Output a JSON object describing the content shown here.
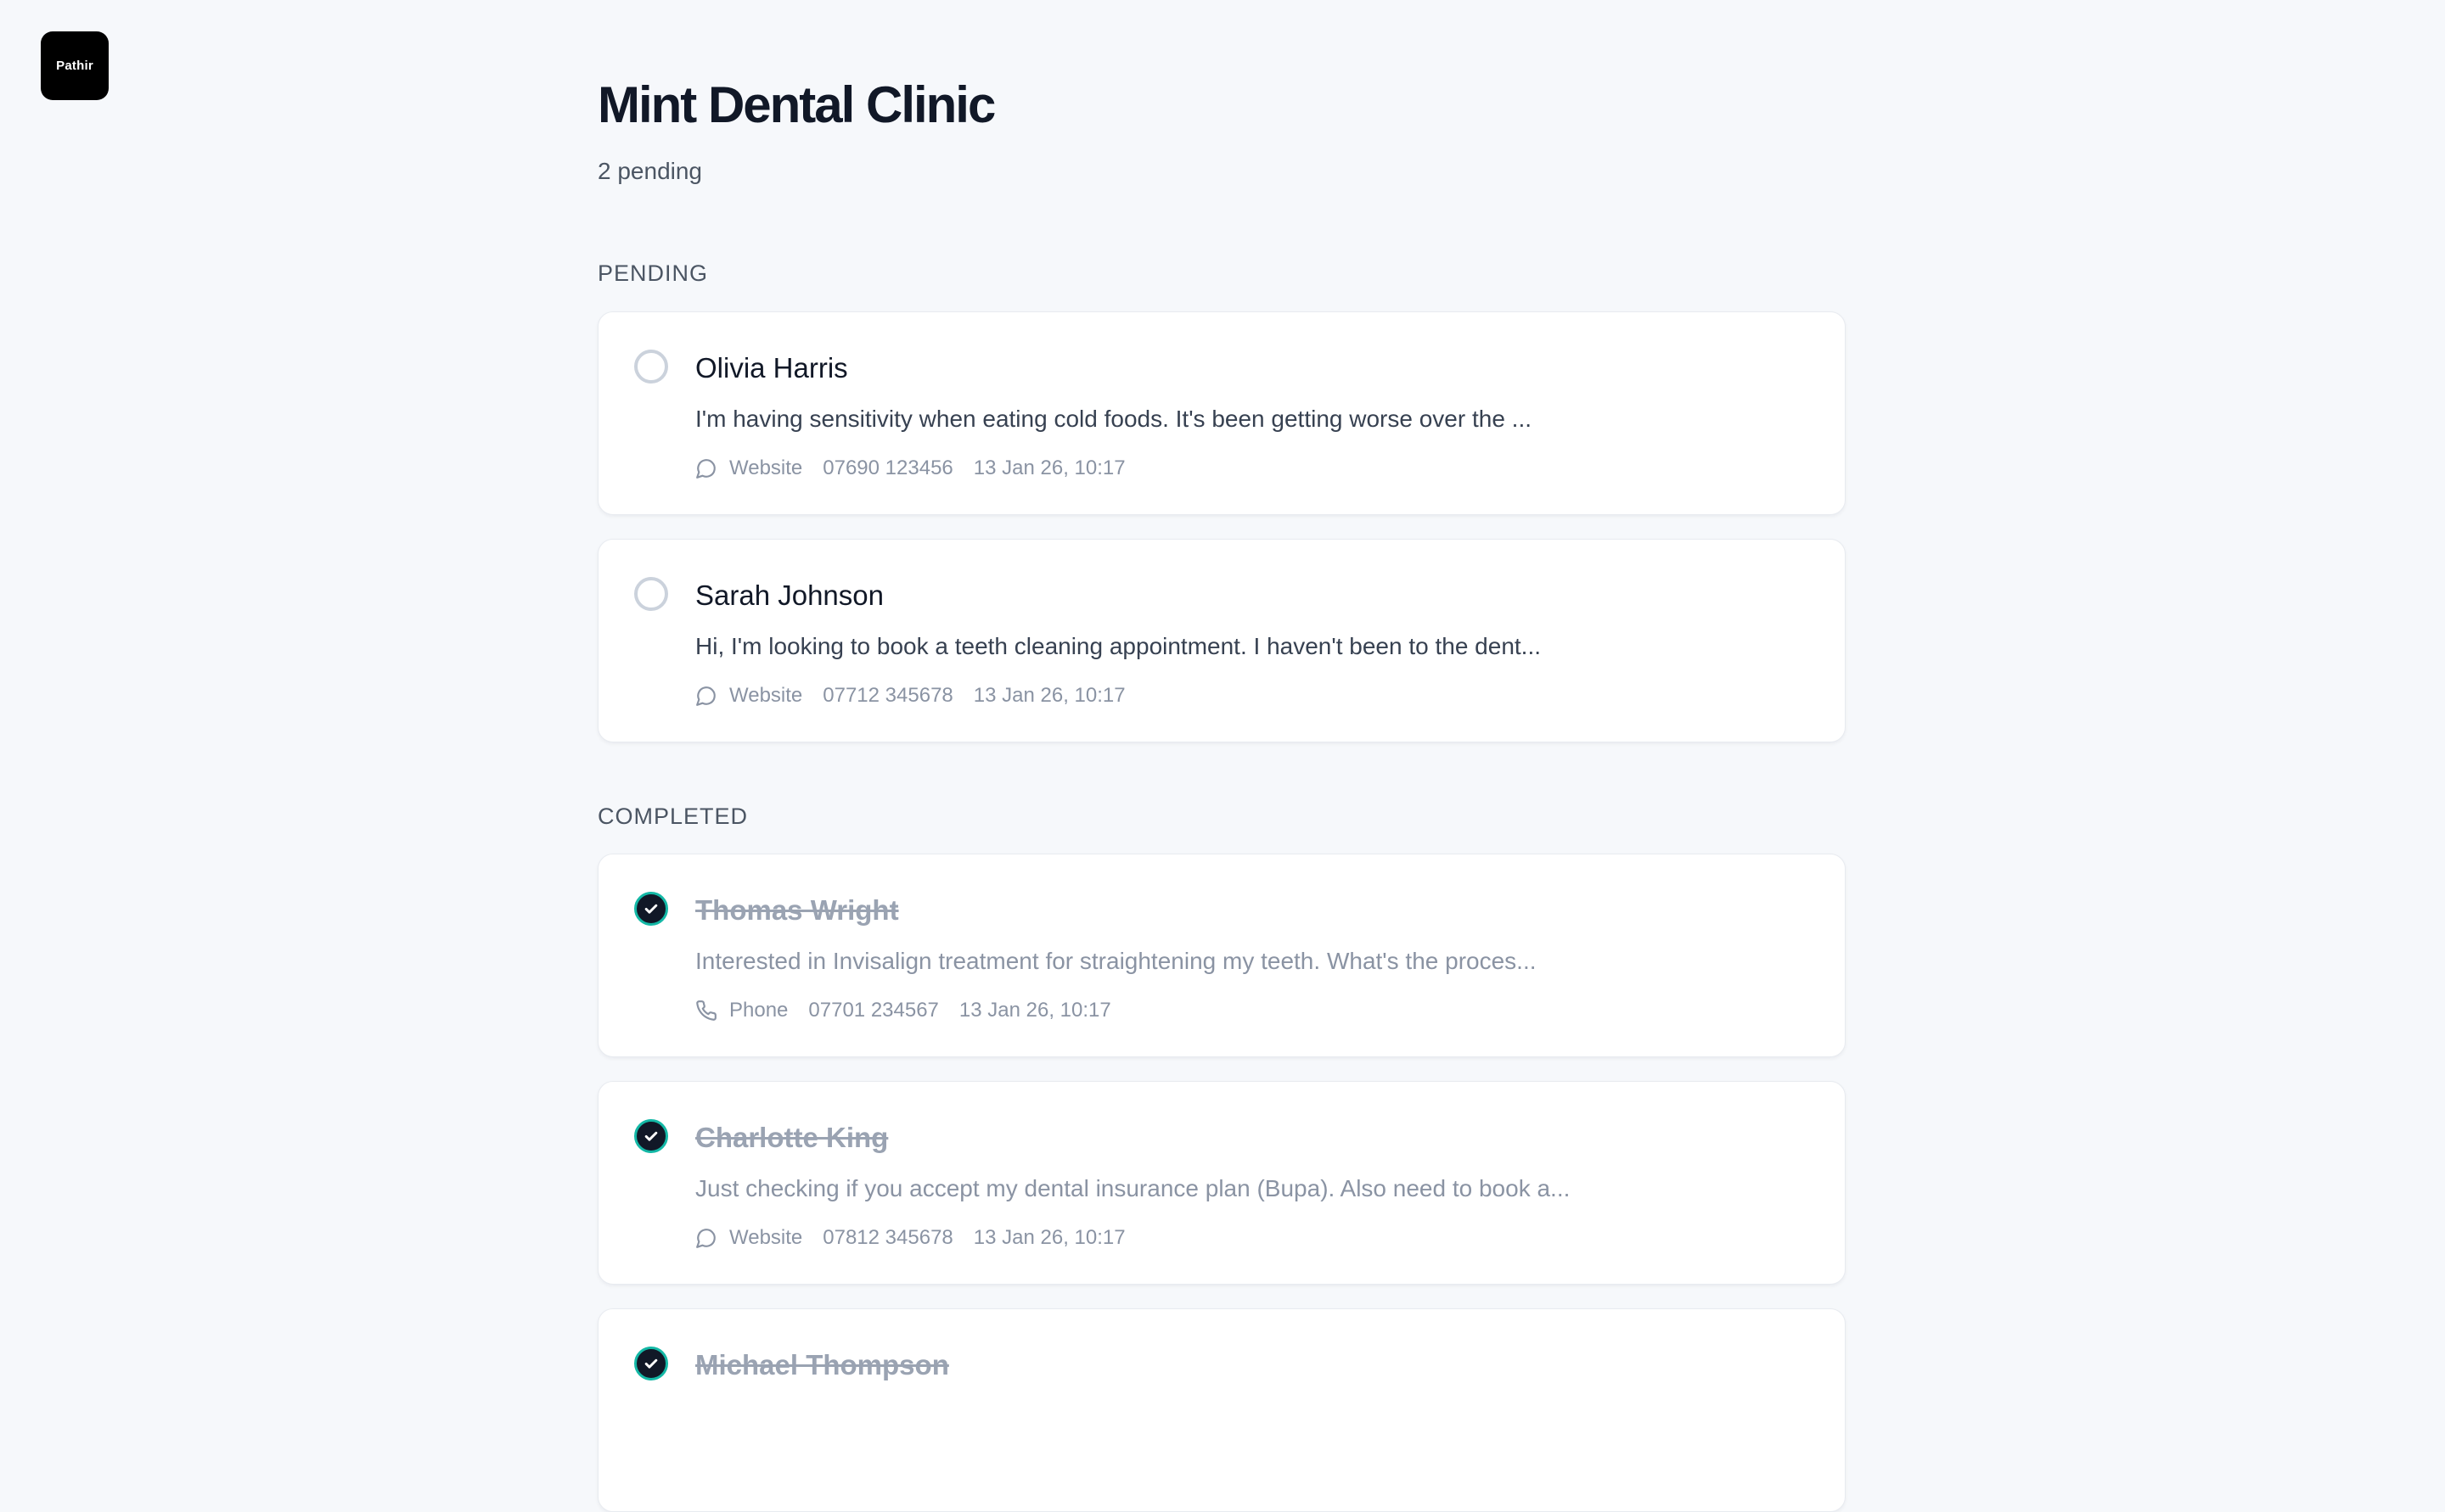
{
  "app": {
    "logo_text": "Pathir"
  },
  "header": {
    "title": "Mint Dental Clinic",
    "subtitle": "2 pending"
  },
  "sections": {
    "pending_label": "PENDING",
    "completed_label": "COMPLETED"
  },
  "pending": [
    {
      "name": "Olivia Harris",
      "message": "I'm having sensitivity when eating cold foods. It's been getting worse over the ...",
      "source": "Website",
      "source_icon": "chat-bubble-icon",
      "phone": "07690 123456",
      "datetime": "13 Jan 26, 10:17"
    },
    {
      "name": "Sarah Johnson",
      "message": "Hi, I'm looking to book a teeth cleaning appointment. I haven't been to the dent...",
      "source": "Website",
      "source_icon": "chat-bubble-icon",
      "phone": "07712 345678",
      "datetime": "13 Jan 26, 10:17"
    }
  ],
  "completed": [
    {
      "name": "Thomas Wright",
      "message": "Interested in Invisalign treatment for straightening my teeth. What's the proces...",
      "source": "Phone",
      "source_icon": "phone-icon",
      "phone": "07701 234567",
      "datetime": "13 Jan 26, 10:17"
    },
    {
      "name": "Charlotte King",
      "message": "Just checking if you accept my dental insurance plan (Bupa). Also need to book a...",
      "source": "Website",
      "source_icon": "chat-bubble-icon",
      "phone": "07812 345678",
      "datetime": "13 Jan 26, 10:17"
    },
    {
      "name": "Michael Thompson"
    }
  ],
  "colors": {
    "background": "#f6f8fb",
    "completed_check": "#111827",
    "completed_check_ring": "#14b8a6"
  }
}
